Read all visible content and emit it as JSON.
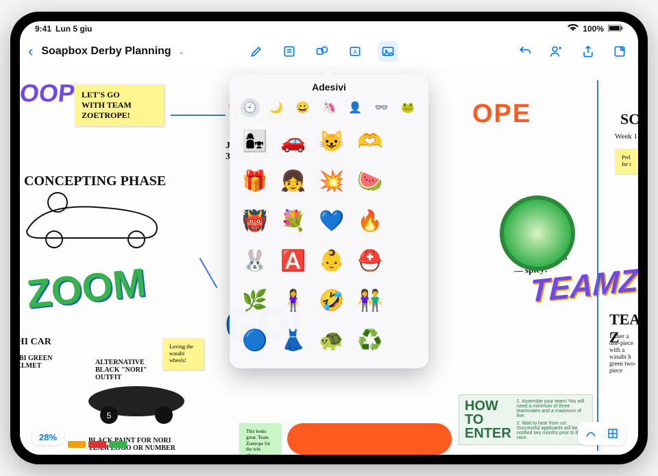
{
  "status": {
    "time": "9:41",
    "date": "Lun 5 giu",
    "battery": "100%"
  },
  "toolbar": {
    "title": "Soapbox Derby Planning",
    "tools": {
      "pen": "pen-icon",
      "note": "note-icon",
      "shape": "shape-icon",
      "text": "text-icon",
      "media": "media-icon"
    },
    "right": {
      "undo": "undo-icon",
      "collab": "collab-icon",
      "share": "share-icon",
      "new": "new-icon"
    }
  },
  "zoom": "28%",
  "sticky1": "LET'S GO\nWITH TEAM\nZOETROPE!",
  "sticky2": "Loving the\nwasabi\nwheels!",
  "sticky3": "This looks\ngreat. Team\nZoetrope for\nthe win\nplease",
  "text": {
    "concept": "CONCEPTING PHASE",
    "jc": "JC'S FINAL\n3D RENDERING",
    "sushi": "SUSHI CAR",
    "wasabi": "WASABI GREEN\nON HELMET",
    "alt": "ALTERNATIVE\nBLACK \"NORI\"\nOUTFIT",
    "paint": "BLACK PAINT FOR NORI\nTEAM LOGO OR NUMBER",
    "love": "Love the\nwasabi wheels\n— spicy!",
    "teamz": "TEAM Z",
    "either": "Either a one-piece\nwith a wasabi h\ngreen two-piece",
    "sc": "SC",
    "week": "Week 1",
    "prel": "Prel\nfor t",
    "how": "HOW",
    "to": "TO",
    "enter": "ENTER",
    "rules1": "1. Assemble your team! You will need a minimum of three teammates and a maximum of five.",
    "rules2": "2. Wait to hear from us! Successful applicants will be notified two months prior to the race."
  },
  "stickers": {
    "title": "Adesivi",
    "categories": [
      "🕘",
      "🌙",
      "😀",
      "🦄",
      "👤",
      "👓",
      "🐸"
    ],
    "grid": [
      "👩‍👧",
      "🚗",
      "😺",
      "🫶",
      "",
      "🎁",
      "👧",
      "💥",
      "🍉",
      "",
      "👹",
      "💐",
      "💙",
      "🔥",
      "",
      "🐰",
      "🅰️",
      "👶",
      "⛑️",
      "",
      "🌿",
      "🧍‍♀️",
      "🤣",
      "👫",
      "",
      "🔵",
      "👗",
      "🐢",
      "♻️",
      ""
    ]
  },
  "bigtext": {
    "zoope": "ZOOPE",
    "zoom": "ZOOM",
    "go": "GO!",
    "team": "TEAM",
    "ope": "OPE",
    "teamz": "TEAMZ"
  },
  "colors": {
    "accent": "#007aff",
    "orange": "#ff5a1f",
    "green": "#37b24d",
    "purple": "#7048e8"
  }
}
